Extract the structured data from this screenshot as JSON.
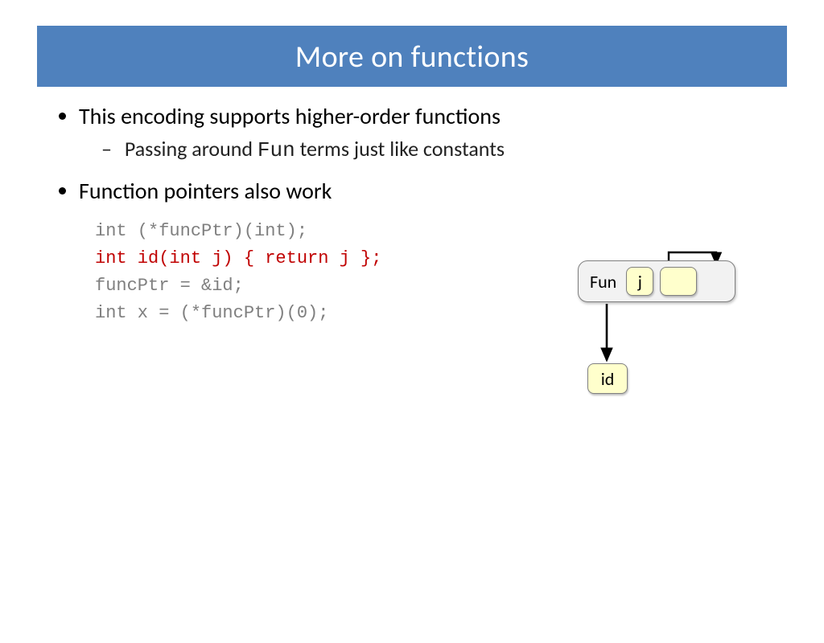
{
  "title": "More on functions",
  "bullets": {
    "b1": "This encoding supports higher-order functions",
    "b1_sub_pre": "Passing around ",
    "b1_sub_code": "Fun",
    "b1_sub_post": " terms just like constants",
    "b2": "Function pointers also work"
  },
  "code": {
    "l1": "int (*funcPtr)(int);",
    "l2": "int id(int j) { return j };",
    "l3": "funcPtr = &id;",
    "l4": "int x = (*funcPtr)(0);"
  },
  "diagram": {
    "fun_label": "Fun",
    "j_label": "j",
    "id_label": "id"
  }
}
